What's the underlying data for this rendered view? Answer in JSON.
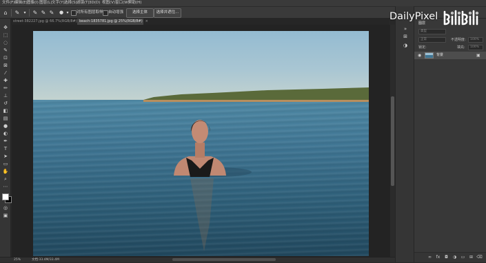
{
  "menu": [
    "文件(F)",
    "编辑(E)",
    "图像(I)",
    "图层(L)",
    "文字(Y)",
    "选择(S)",
    "滤镜(T)",
    "3D(D)",
    "视图(V)",
    "窗口(W)",
    "帮助(H)"
  ],
  "options": {
    "sample_all_layers_label": "对所有图层取样",
    "auto_enhance_label": "自动增强",
    "select_subject_label": "选择主体",
    "select_and_mask_label": "选择并遮住..."
  },
  "tabs": [
    {
      "label": "street-382227.jpg @ 66.7%(RGB/8#)",
      "active": false
    },
    {
      "label": "beach-1835781.jpg @ 25%(RGB/8#)",
      "active": true
    }
  ],
  "layers_panel": {
    "title": "图层",
    "kind_placeholder": "类型",
    "blend_mode": "正常",
    "opacity_label": "不透明度:",
    "opacity_value": "100%",
    "lock_label": "锁定:",
    "fill_label": "填充:",
    "fill_value": "100%",
    "layers": [
      {
        "name": "背景",
        "visible": true,
        "locked": true
      }
    ]
  },
  "status": {
    "zoom": "25%",
    "doc_info": "文档:33.4M/33.4M"
  },
  "watermark": {
    "text": "DailyPixel",
    "logo_text": "bilibili"
  },
  "icons": {
    "home": "home-icon",
    "quick_select": "quick-select-icon",
    "visibility": "eye-icon",
    "lock": "lock-icon"
  }
}
